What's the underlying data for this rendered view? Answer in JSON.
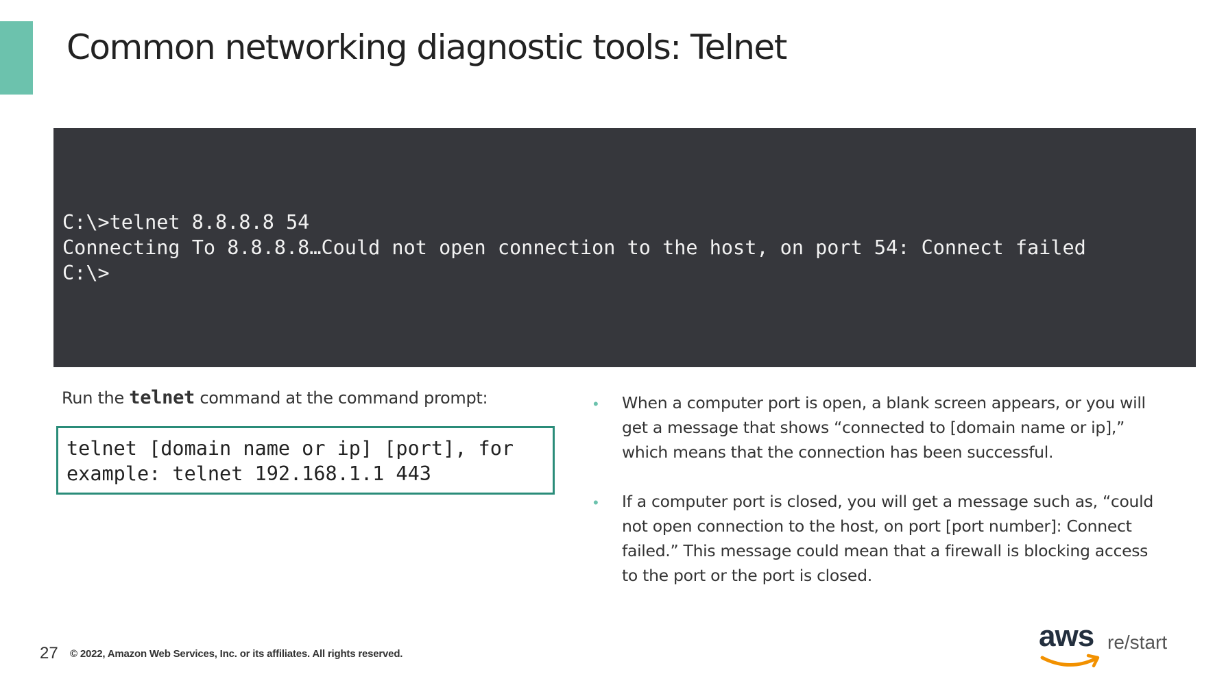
{
  "slide": {
    "title": "Common networking diagnostic tools: Telnet",
    "accent_color": "#6cc2ad"
  },
  "terminal": {
    "background": "#36373c",
    "lines": [
      "C:\\>telnet 8.8.8.8 54",
      "Connecting To 8.8.8.8…Could not open connection to the host, on port 54: Connect failed",
      "C:\\>"
    ]
  },
  "intro": {
    "before": "Run the ",
    "command": "telnet",
    "after": " command at the command prompt:"
  },
  "syntax_box": {
    "border_color": "#2a8c79",
    "lines": [
      "telnet [domain name or ip] [port], for",
      "example: telnet 192.168.1.1 443"
    ]
  },
  "bullets": [
    {
      "text": "When a computer port is open, a blank screen appears, or you will get a message that shows “connected to [domain name or ip],” which means that the connection has been successful."
    },
    {
      "text": "If a computer port is closed, you will get a message such as, “could not open connection to the host, on port [port number]: Connect failed.” This message could mean that a firewall is blocking access to the port or the port is closed."
    }
  ],
  "footer": {
    "page_number": "27",
    "copyright": "© 2022, Amazon Web Services, Inc. or its affiliates. All rights reserved.",
    "logo": {
      "aws": "aws",
      "restart": "re/start",
      "smile_color": "#f29100",
      "icon": "aws-smile-arrow-icon"
    }
  }
}
